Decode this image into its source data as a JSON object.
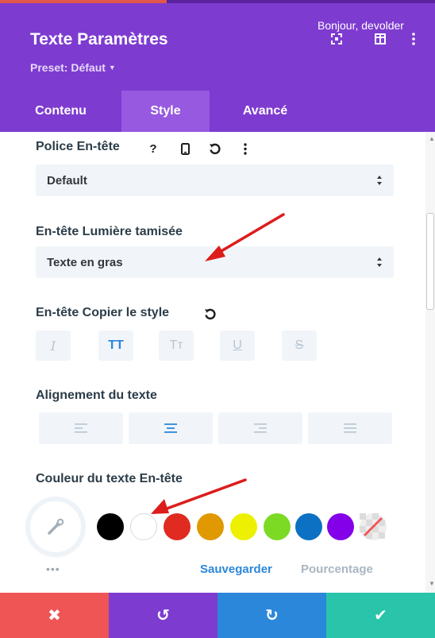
{
  "header": {
    "title": "Texte Paramètres",
    "preset_label": "Preset: Défaut",
    "greeting": "Bonjour, devolder",
    "icons": [
      "expand-icon",
      "columns-icon",
      "more-icon"
    ]
  },
  "tabs": [
    {
      "label": "Contenu",
      "active": false
    },
    {
      "label": "Style",
      "active": true
    },
    {
      "label": "Avancé",
      "active": false
    }
  ],
  "fields": {
    "heading_font": {
      "label": "Police En-tête",
      "help_glyph": "?",
      "value": "Default"
    },
    "heading_weight": {
      "label": "En-tête Lumière tamisée",
      "value": "Texte en gras"
    },
    "heading_style": {
      "label": "En-tête Copier le style",
      "buttons": [
        {
          "glyph": "I",
          "name": "italic",
          "active": false
        },
        {
          "glyph": "TT",
          "name": "uppercase",
          "active": true
        },
        {
          "glyph": "Tт",
          "name": "capitalize",
          "active": false
        },
        {
          "glyph": "U",
          "name": "underline",
          "active": false
        },
        {
          "glyph": "S",
          "name": "strikethrough",
          "active": false
        }
      ]
    },
    "text_align": {
      "label": "Alignement du texte",
      "options": [
        "left",
        "center",
        "right",
        "justify"
      ],
      "selected": "center"
    },
    "heading_color": {
      "label": "Couleur du texte En-tête",
      "swatches": [
        "#000000",
        "#ffffff",
        "#e02b20",
        "#e09900",
        "#edf000",
        "#7cda24",
        "#0c71c3",
        "#8300e9",
        "none"
      ],
      "save_label": "Sauvegarder",
      "percent_label": "Pourcentage",
      "more_glyph": "•••"
    }
  },
  "footer": {
    "buttons": [
      {
        "name": "cancel",
        "glyph": "✖",
        "color": "#ef5555"
      },
      {
        "name": "undo",
        "glyph": "↺",
        "color": "#7e3bd0"
      },
      {
        "name": "redo",
        "glyph": "↻",
        "color": "#2b87da"
      },
      {
        "name": "save",
        "glyph": "✔",
        "color": "#29c4a9"
      }
    ]
  },
  "colors": {
    "header": "#7e3bd0",
    "tab_active": "#9659e0",
    "accent_blue": "#2b87da",
    "annotation_red": "#dd1c1c"
  }
}
